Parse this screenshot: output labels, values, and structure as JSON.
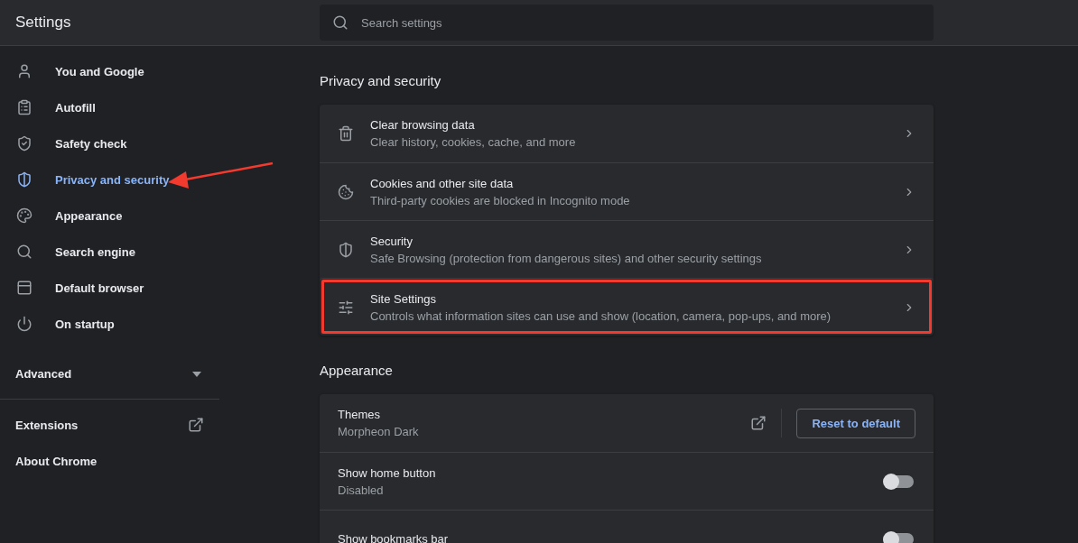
{
  "header": {
    "title": "Settings",
    "search": {
      "placeholder": "Search settings"
    }
  },
  "sidebar": {
    "items": [
      {
        "label": "You and Google",
        "selected": false,
        "annotated": false
      },
      {
        "label": "Autofill",
        "selected": false,
        "annotated": false
      },
      {
        "label": "Safety check",
        "selected": false,
        "annotated": false
      },
      {
        "label": "Privacy and security",
        "selected": true,
        "annotated": true
      },
      {
        "label": "Appearance",
        "selected": false,
        "annotated": false
      },
      {
        "label": "Search engine",
        "selected": false,
        "annotated": false
      },
      {
        "label": "Default browser",
        "selected": false,
        "annotated": false
      },
      {
        "label": "On startup",
        "selected": false,
        "annotated": false
      }
    ],
    "advanced": {
      "label": "Advanced",
      "expanded": false
    },
    "links": [
      {
        "label": "Extensions",
        "kind": "external"
      },
      {
        "label": "About Chrome",
        "kind": "plain"
      }
    ]
  },
  "sections": [
    {
      "title": "Privacy and security",
      "rows": [
        {
          "kind": "link",
          "title": "Clear browsing data",
          "subtitle": "Clear history, cookies, cache, and more",
          "highlighted": false
        },
        {
          "kind": "link",
          "title": "Cookies and other site data",
          "subtitle": "Third-party cookies are blocked in Incognito mode",
          "highlighted": false
        },
        {
          "kind": "link",
          "title": "Security",
          "subtitle": "Safe Browsing (protection from dangerous sites) and other security settings",
          "highlighted": false
        },
        {
          "kind": "link",
          "title": "Site Settings",
          "subtitle": "Controls what information sites can use and show (location, camera, pop-ups, and more)",
          "highlighted": true
        }
      ]
    },
    {
      "title": "Appearance",
      "rows": [
        {
          "kind": "theme",
          "title": "Themes",
          "subtitle": "Morpheon Dark",
          "button": "Reset to default"
        },
        {
          "kind": "toggle",
          "title": "Show home button",
          "subtitle": "Disabled",
          "on": false
        },
        {
          "kind": "toggle",
          "title": "Show bookmarks bar",
          "on": false
        }
      ]
    }
  ]
}
